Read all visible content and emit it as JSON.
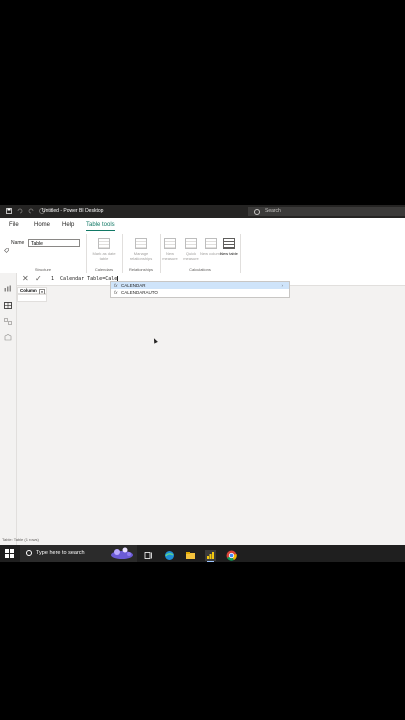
{
  "window": {
    "title": "Untitled - Power BI Desktop"
  },
  "search": {
    "placeholder": "Search"
  },
  "menu": {
    "items": [
      "File",
      "Home",
      "Help",
      "Table tools"
    ]
  },
  "ribbon": {
    "structure": {
      "name_label": "Name",
      "name_value": "Table",
      "group_label": "Structure"
    },
    "calendars": {
      "button": "Mark as date table",
      "group_label": "Calendars"
    },
    "relationships": {
      "button": "Manage relationships",
      "group_label": "Relationships"
    },
    "calculations": {
      "buttons": [
        "New measure",
        "Quick measure",
        "New column",
        "New table"
      ],
      "group_label": "Calculations"
    }
  },
  "formula": {
    "line_number": "1",
    "text": "Calendar Table=Cale"
  },
  "autocomplete": {
    "items": [
      "CALENDAR",
      "CALENDARAUTO"
    ]
  },
  "table": {
    "column_header": "Column"
  },
  "status": {
    "text": "Table: Table (1 rows)"
  },
  "taskbar": {
    "search_placeholder": "Type here to search"
  },
  "colors": {
    "accent": "#117865",
    "titlebar": "#252423",
    "taskbar": "#1f1f1f"
  }
}
